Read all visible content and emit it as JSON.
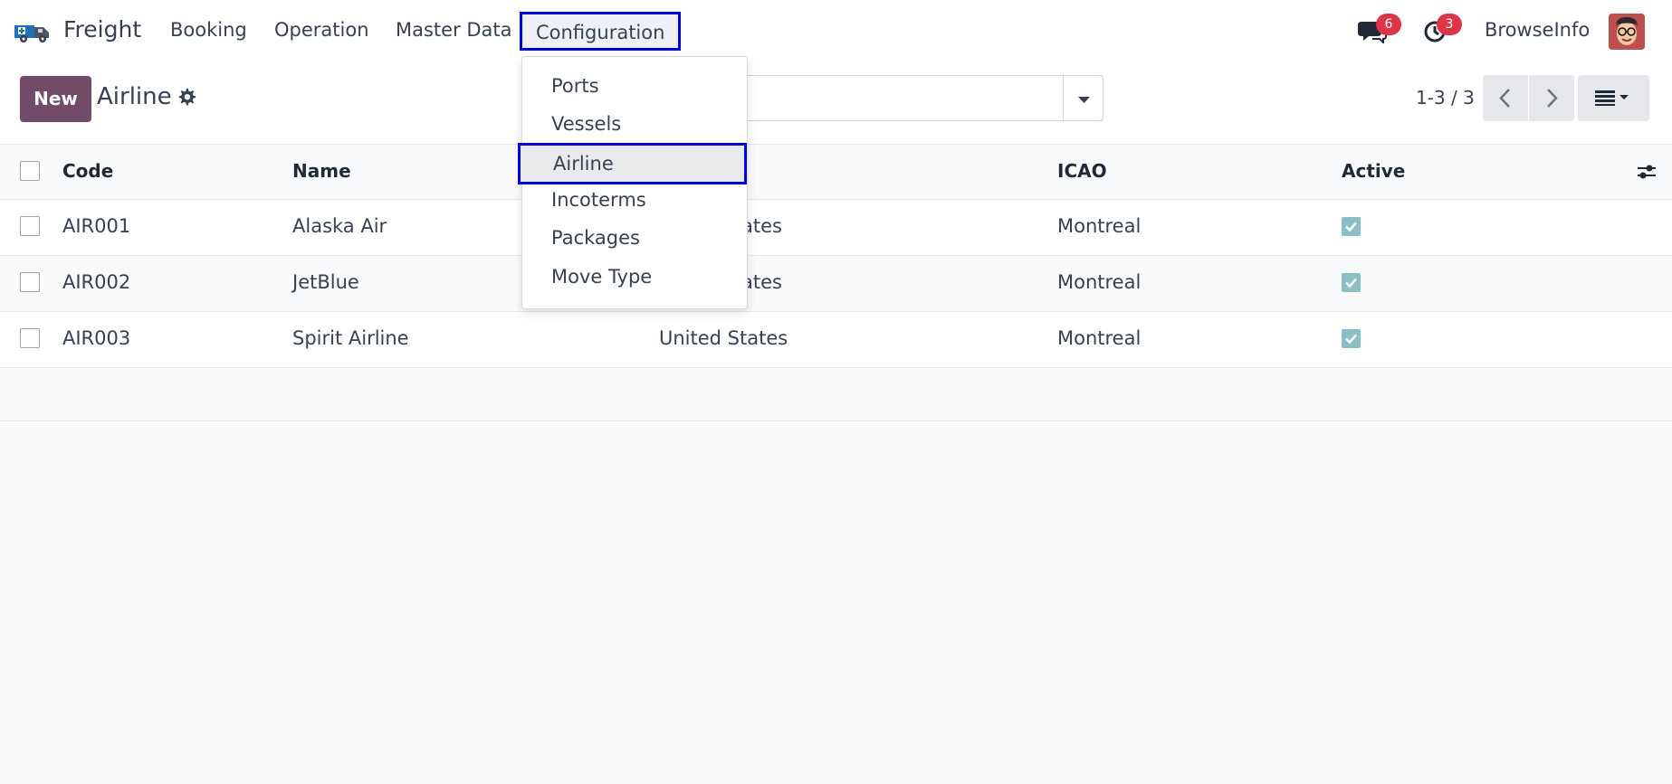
{
  "navbar": {
    "brand": "Freight",
    "menu": [
      {
        "label": "Booking"
      },
      {
        "label": "Operation"
      },
      {
        "label": "Master Data"
      },
      {
        "label": "Configuration"
      }
    ],
    "messages_count": "6",
    "activities_count": "3",
    "user_name": "BrowseInfo"
  },
  "control_panel": {
    "new_label": "New",
    "title": "Airline",
    "pager": "1-3 / 3"
  },
  "table": {
    "headers": {
      "code": "Code",
      "name": "Name",
      "icao": "ICAO",
      "active": "Active"
    },
    "rows": [
      {
        "code": "AIR001",
        "name": "Alaska Air",
        "country": "ates",
        "icao": "Montreal",
        "active": true
      },
      {
        "code": "AIR002",
        "name": "JetBlue",
        "country": "ates",
        "icao": "Montreal",
        "active": true
      },
      {
        "code": "AIR003",
        "name": "Spirit Airline",
        "country": "United States",
        "icao": "Montreal",
        "active": true
      }
    ]
  },
  "dropdown": {
    "items": [
      {
        "label": "Ports"
      },
      {
        "label": "Vessels"
      },
      {
        "label": "Airline"
      },
      {
        "label": "Incoterms"
      },
      {
        "label": "Packages"
      },
      {
        "label": "Move Type"
      }
    ]
  },
  "colors": {
    "brand_primary": "#714b67",
    "highlight_border": "#0000d8",
    "badge": "#dc3545",
    "checkbox_checked": "#8bbfc5"
  }
}
